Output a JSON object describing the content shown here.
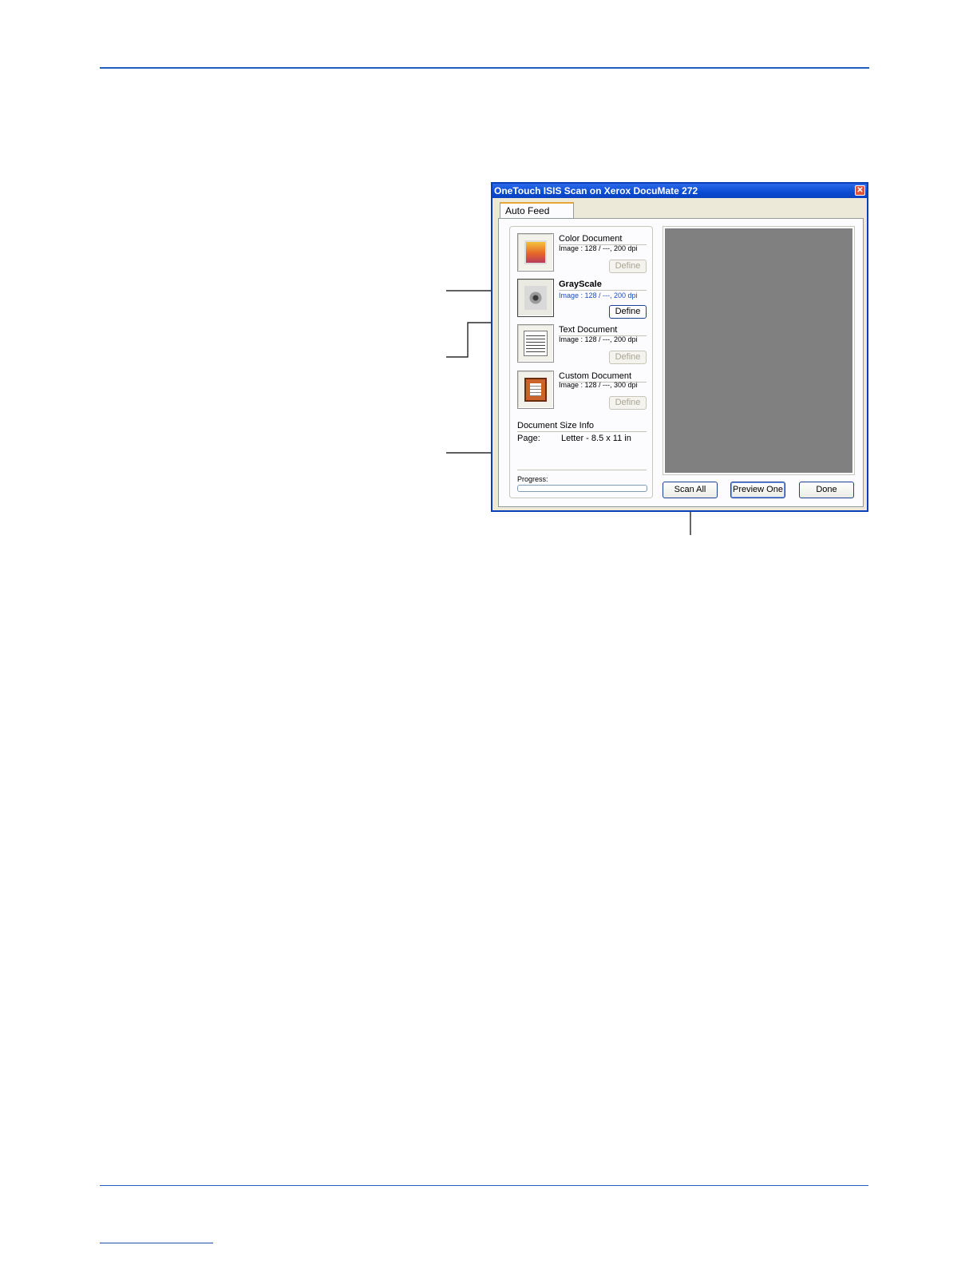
{
  "window": {
    "title": "OneTouch ISIS Scan on Xerox DocuMate 272",
    "close_glyph": "✕"
  },
  "tabs": [
    {
      "label": "Auto Feed",
      "active": true
    }
  ],
  "profiles": [
    {
      "name": "Color Document",
      "info": "Image : 128 / ---, 200 dpi",
      "define_label": "Define",
      "icon": "color-document-icon",
      "enabled": false
    },
    {
      "name": "GrayScale",
      "info": "Image : 128 / ---, 200 dpi",
      "define_label": "Define",
      "icon": "grayscale-eye-icon",
      "enabled": true,
      "selected": true
    },
    {
      "name": "Text Document",
      "info": "Image : 128 / ---, 200 dpi",
      "define_label": "Define",
      "icon": "text-document-icon",
      "enabled": false
    },
    {
      "name": "Custom Document",
      "info": "Image : 128 / ---, 300 dpi",
      "define_label": "Define",
      "icon": "custom-document-icon",
      "enabled": false
    }
  ],
  "document_size": {
    "header": "Document Size Info",
    "page_label": "Page:",
    "page_value": "Letter - 8.5 x 11 in"
  },
  "progress": {
    "label": "Progress:",
    "value": 0
  },
  "buttons": {
    "scan_all": "Scan All",
    "preview_one": "Preview One",
    "done": "Done"
  },
  "colors": {
    "title_bar": "#0a4bd4",
    "preview_area": "#808080",
    "page_rule": "#1f5fbf"
  }
}
